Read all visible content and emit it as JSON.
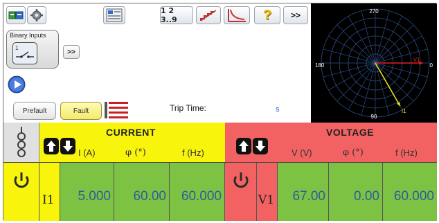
{
  "toolbar": {
    "sequence_label": "1 2 3..9",
    "more_label": ">>",
    "help_label": "?"
  },
  "binary_inputs": {
    "label": "Binary Inputs",
    "more_label": ">>"
  },
  "controls": {
    "prefault_label": "Prefault",
    "fault_label": "Fault",
    "trip_time_label": "Trip Time:",
    "trip_time_unit": "s"
  },
  "phasor": {
    "angle_top": "270",
    "angle_left": "180",
    "angle_right": "0",
    "angle_bottom": "90",
    "vectors": [
      {
        "name": "V1",
        "magnitude": 67.0,
        "angle_deg": 0.0,
        "color": "#e02020"
      },
      {
        "name": "I1",
        "magnitude": 5.0,
        "angle_deg": 60.0,
        "color": "#e8e020"
      }
    ]
  },
  "current": {
    "title": "CURRENT",
    "col_amp": "I (A)",
    "col_phase": "φ (°)",
    "col_freq": "f (Hz)",
    "channel": "I1",
    "amplitude": "5.000",
    "phase": "60.00",
    "frequency": "60.000"
  },
  "voltage": {
    "title": "VOLTAGE",
    "col_amp": "V (V)",
    "col_phase": "φ (°)",
    "col_freq": "f (Hz)",
    "channel": "V1",
    "amplitude": "67.00",
    "phase": "0.00",
    "frequency": "60.000"
  },
  "colors": {
    "current_header": "#f8f40c",
    "voltage_header": "#f26262",
    "value_cell": "#7dc242",
    "value_text": "#2a5f9e"
  }
}
